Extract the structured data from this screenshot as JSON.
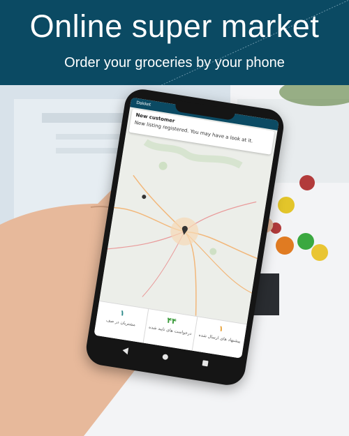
{
  "banner": {
    "title": "Online super market",
    "subtitle": "Order your groceries by your phone"
  },
  "phone": {
    "status_app": "Dakket",
    "notification": {
      "title": "New customer",
      "body": "New listing registered. You may have a look at it."
    },
    "stats": [
      {
        "number": "۱",
        "label": "پیشنهاد های ارسال شده",
        "color": "#e8a33c"
      },
      {
        "number": "۴۴",
        "label": "درخواست های تایید شده",
        "color": "#3a9a3a"
      },
      {
        "number": "۱",
        "label": "مشتریان در صف",
        "color": "#2f8a8a"
      }
    ],
    "nav_icons": [
      "back-icon",
      "home-icon",
      "recent-apps-icon"
    ]
  },
  "colors": {
    "banner_bg": "#0b4a63",
    "banner_text": "#ffffff"
  }
}
